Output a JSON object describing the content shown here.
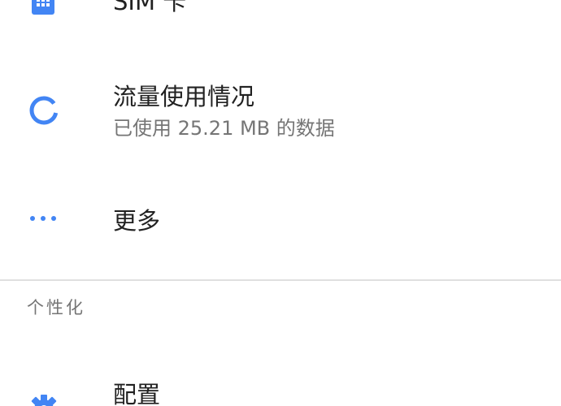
{
  "items": {
    "sim": {
      "title": "SIM 卡",
      "icon": "sim-card-icon"
    },
    "data_usage": {
      "title": "流量使用情况",
      "subtitle": "已使用 25.21 MB 的数据",
      "icon": "data-usage-icon"
    },
    "more": {
      "title": "更多",
      "icon": "more-horiz-icon"
    },
    "config": {
      "title": "配置",
      "icon": "gear-icon"
    }
  },
  "sections": {
    "personalization": {
      "header": "个性化"
    }
  },
  "colors": {
    "accent": "#4285f4",
    "primary_text": "#212121",
    "secondary_text": "#757575",
    "divider": "#e0e0e0"
  }
}
